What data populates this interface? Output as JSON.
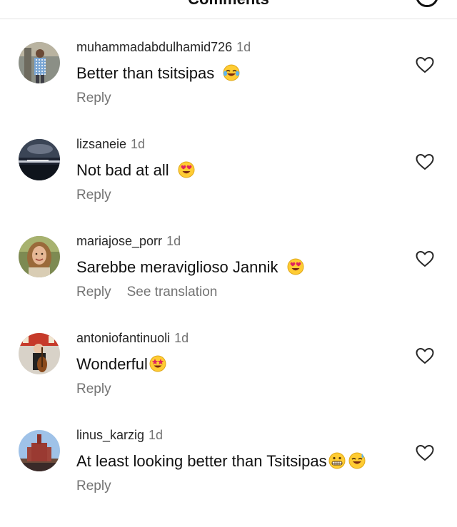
{
  "header": {
    "title": "Comments",
    "action_icon": "circle-icon"
  },
  "comments": [
    {
      "username": "muhammadabdulhamid726",
      "time": "1d",
      "text": "Better than tsitsipas",
      "emoji": "tears-of-joy-emoji",
      "reply_label": "Reply",
      "like_icon": "heart-outline-icon"
    },
    {
      "username": "lizsaneie",
      "time": "1d",
      "text": "Not bad at all",
      "emoji": "heart-eyes-emoji",
      "reply_label": "Reply",
      "like_icon": "heart-outline-icon"
    },
    {
      "username": "mariajose_porr",
      "time": "1d",
      "text": "Sarebbe meraviglioso Jannik",
      "emoji": "heart-eyes-emoji",
      "reply_label": "Reply",
      "translate_label": "See translation",
      "like_icon": "heart-outline-icon"
    },
    {
      "username": "antoniofantinuoli",
      "time": "1d",
      "text": "Wonderful",
      "emoji": "star-struck-emoji",
      "reply_label": "Reply",
      "like_icon": "heart-outline-icon"
    },
    {
      "username": "linus_karzig",
      "time": "1d",
      "text": "At least looking better than Tsitsipas",
      "emoji": "grimacing-emoji, sweat-smile-emoji",
      "reply_label": "Reply",
      "like_icon": "heart-outline-icon"
    }
  ],
  "colors": {
    "username": "#262626",
    "secondary_text": "#737373",
    "body_text": "#111111",
    "divider": "#e3e3e3",
    "emoji_face": "#ffcc33"
  }
}
